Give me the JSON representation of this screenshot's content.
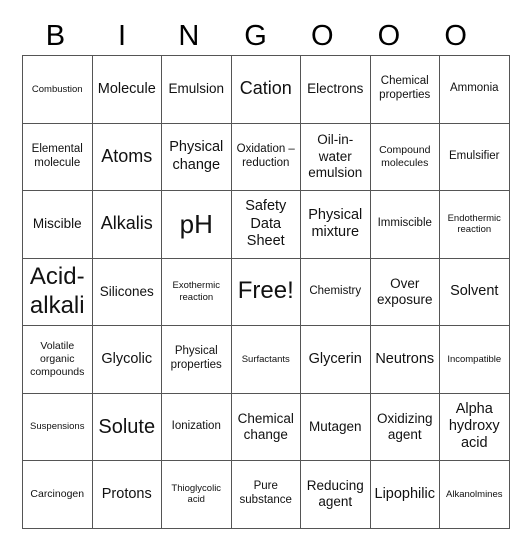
{
  "header": {
    "letters": [
      "B",
      "I",
      "N",
      "G",
      "O",
      "O",
      "O"
    ]
  },
  "rows": [
    [
      "Combustion",
      "Molecule",
      "Emulsion",
      "Cation",
      "Electrons",
      "Chemical properties",
      "Ammonia"
    ],
    [
      "Elemental molecule",
      "Atoms",
      "Physical change",
      "Oxidation – reduction",
      "Oil-in-water emulsion",
      "Compound molecules",
      "Emulsifier"
    ],
    [
      "Miscible",
      "Alkalis",
      "pH",
      "Safety Data Sheet",
      "Physical mixture",
      "Immiscible",
      "Endothermic reaction"
    ],
    [
      "Acid-alkali",
      "Silicones",
      "Exothermic reaction",
      "Free!",
      "Chemistry",
      "Over exposure",
      "Solvent"
    ],
    [
      "Volatile organic compounds",
      "Glycolic",
      "Physical properties",
      "Surfactants",
      "Glycerin",
      "Neutrons",
      "Incompatible"
    ],
    [
      "Suspensions",
      "Solute",
      "Ionization",
      "Chemical change",
      "Mutagen",
      "Oxidizing agent",
      "Alpha hydroxy acid"
    ],
    [
      "Carcinogen",
      "Protons",
      "Thioglycolic acid",
      "Pure substance",
      "Reducing agent",
      "Lipophilic",
      "Alkanolmines"
    ]
  ]
}
